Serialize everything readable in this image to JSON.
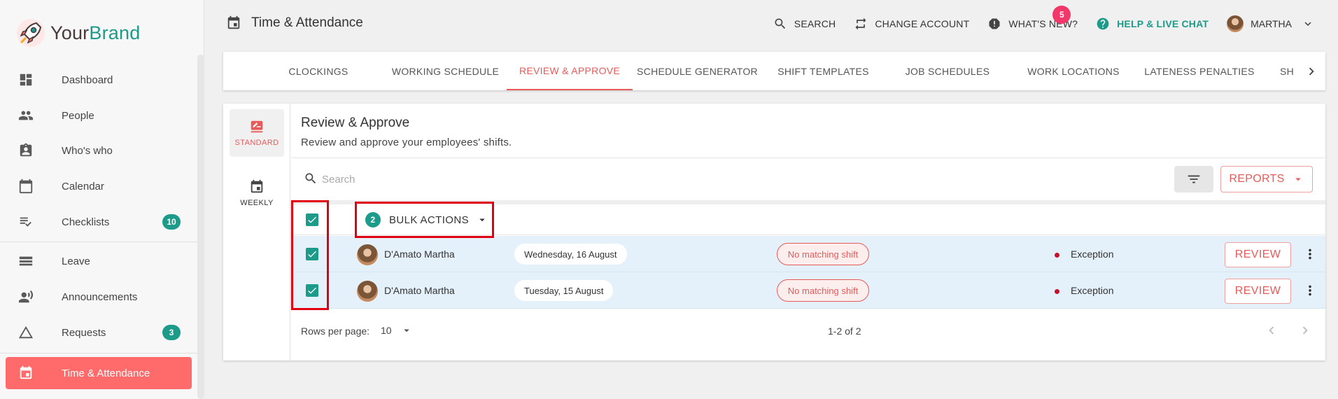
{
  "brand": {
    "your": "Your",
    "brand": "Brand"
  },
  "sidebar": {
    "items": [
      {
        "label": "Dashboard",
        "icon": "dashboard-icon"
      },
      {
        "label": "People",
        "icon": "people-icon"
      },
      {
        "label": "Who's who",
        "icon": "badge-icon"
      },
      {
        "label": "Calendar",
        "icon": "calendar-icon"
      },
      {
        "label": "Checklists",
        "icon": "checklist-icon",
        "badge": "10"
      },
      {
        "label": "Leave",
        "icon": "leave-icon"
      },
      {
        "label": "Announcements",
        "icon": "announcement-icon"
      },
      {
        "label": "Requests",
        "icon": "triangle-icon",
        "badge": "3"
      },
      {
        "label": "Time & Attendance",
        "icon": "event-icon",
        "active": true
      }
    ]
  },
  "header": {
    "title": "Time & Attendance",
    "search": "SEARCH",
    "change_account": "CHANGE ACCOUNT",
    "whats_new": "WHAT'S NEW?",
    "whats_new_badge": "5",
    "help": "HELP & LIVE CHAT",
    "user": "MARTHA"
  },
  "tabs": [
    {
      "label": "CLOCKINGS"
    },
    {
      "label": "WORKING SCHEDULE"
    },
    {
      "label": "REVIEW & APPROVE",
      "active": true
    },
    {
      "label": "SCHEDULE GENERATOR"
    },
    {
      "label": "SHIFT TEMPLATES"
    },
    {
      "label": "JOB SCHEDULES"
    },
    {
      "label": "WORK LOCATIONS"
    },
    {
      "label": "LATENESS PENALTIES"
    },
    {
      "label": "SH"
    }
  ],
  "modes": {
    "standard": "STANDARD",
    "weekly": "WEEKLY"
  },
  "content": {
    "title": "Review & Approve",
    "subtitle": "Review and approve your employees' shifts.",
    "search_placeholder": "Search",
    "reports": "REPORTS",
    "bulk_count": "2",
    "bulk_label": "BULK ACTIONS"
  },
  "rows": [
    {
      "name": "D'Amato Martha",
      "date": "Wednesday, 16 August",
      "chip": "No matching shift",
      "status": "Exception",
      "action": "REVIEW"
    },
    {
      "name": "D'Amato Martha",
      "date": "Tuesday, 15 August",
      "chip": "No matching shift",
      "status": "Exception",
      "action": "REVIEW"
    }
  ],
  "footer": {
    "rows_per_page_label": "Rows per page:",
    "rows_per_page": "10",
    "page_info": "1-2 of 2"
  },
  "colors": {
    "accent": "#1c9a8a",
    "primary": "#ff6b6b",
    "danger": "#e85a5a",
    "highlight": "#e0000f"
  }
}
